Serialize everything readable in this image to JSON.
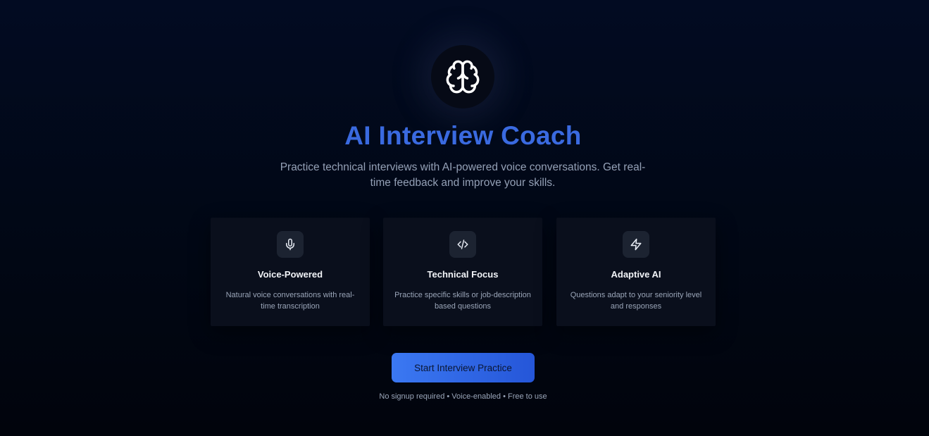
{
  "hero": {
    "logo_icon": "brain-icon",
    "title": "AI Interview Coach",
    "subtitle": "Practice technical interviews with AI-powered voice conversations. Get real-time feedback and improve your skills."
  },
  "features": [
    {
      "icon": "microphone-icon",
      "title": "Voice-Powered",
      "description": "Natural voice conversations with real-time transcription"
    },
    {
      "icon": "code-icon",
      "title": "Technical Focus",
      "description": "Practice specific skills or job-description based questions"
    },
    {
      "icon": "lightning-icon",
      "title": "Adaptive AI",
      "description": "Questions adapt to your seniority level and responses"
    }
  ],
  "cta": {
    "label": "Start Interview Practice"
  },
  "footnote": "No signup required • Voice-enabled • Free to use",
  "colors": {
    "accent": "#3a6ae0",
    "button_start": "#3b78f2",
    "button_end": "#2556d8",
    "background": "#010817"
  }
}
